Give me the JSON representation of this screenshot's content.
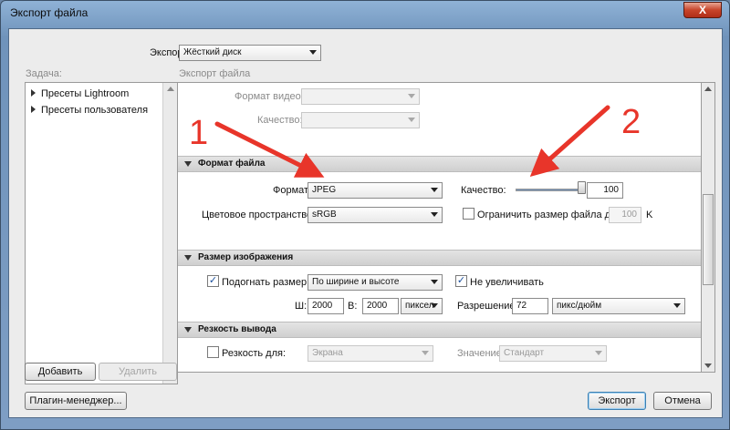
{
  "window": {
    "title": "Экспорт файла",
    "close_glyph": "X"
  },
  "export_row": {
    "label": "Экспорт:",
    "value": "Жёсткий диск"
  },
  "left": {
    "header": "Задача:",
    "items": [
      {
        "label": "Пресеты Lightroom"
      },
      {
        "label": "Пресеты пользователя"
      }
    ],
    "add_label": "Добавить",
    "remove_label": "Удалить"
  },
  "right": {
    "header": "Экспорт файла",
    "video_format_label": "Формат видео:",
    "video_quality_label": "Качество:",
    "file_format": {
      "title": "Формат файла",
      "format_label": "Формат:",
      "format_value": "JPEG",
      "quality_label": "Качество:",
      "quality_value": "100",
      "quality_fraction": 1.0,
      "colorspace_label": "Цветовое пространство:",
      "colorspace_value": "sRGB",
      "limit_label": "Ограничить размер файла до:",
      "limit_value": "100",
      "limit_unit": "K"
    },
    "image_size": {
      "title": "Размер изображения",
      "fit_label": "Подогнать размер",
      "fit_value": "По ширине и высоте",
      "no_enlarge_label": "Не увеличивать",
      "w_label": "Ш:",
      "w_value": "2000",
      "h_label": "В:",
      "h_value": "2000",
      "unit_value": "пиксел",
      "resolution_label": "Разрешение:",
      "resolution_value": "72",
      "resolution_unit": "пикс/дюйм"
    },
    "sharpen": {
      "title": "Резкость вывода",
      "for_label": "Резкость для:",
      "for_value": "Экрана",
      "amount_label": "Значение:",
      "amount_value": "Стандарт"
    }
  },
  "annotations": {
    "n1": "1",
    "n2": "2",
    "color": "#e8352a"
  },
  "footer": {
    "plugin_label": "Плагин-менеджер...",
    "export_label": "Экспорт",
    "cancel_label": "Отмена"
  },
  "checks": {
    "mark": "✓"
  }
}
